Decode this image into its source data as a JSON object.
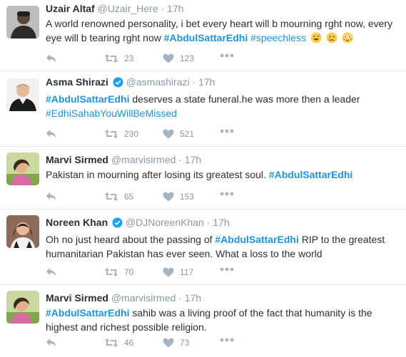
{
  "tweets": [
    {
      "name": "Uzair Altaf",
      "handle": "@Uzair_Here",
      "dot": "·",
      "time": "17h",
      "verified": false,
      "text_plain": "A world renowned personality, i bet every heart will b mourning rght now, every eye will b tearing rght now ",
      "hashtag1": "#AbdulSattarEdhi",
      "hashtag2": "#speechless",
      "emojis": [
        "grin-sweat-icon",
        "crying-face-icon",
        "flushed-face-icon"
      ],
      "retweets": "23",
      "likes": "123"
    },
    {
      "name": "Asma Shirazi",
      "handle": "@asmashirazi",
      "dot": "·",
      "time": "17h",
      "verified": true,
      "hashtag1": "#AbdulSattarEdhi",
      "text_plain": " deserves a state funeral.he was more then a leader",
      "hashtag2": "#EdhiSahabYouWillBeMissed",
      "retweets": "230",
      "likes": "521"
    },
    {
      "name": "Marvi Sirmed",
      "handle": "@marvisirmed",
      "dot": "·",
      "time": "17h",
      "verified": false,
      "text_plain": "Pakistan in mourning after losing its greatest soul. ",
      "hashtag1": "#AbdulSattarEdhi",
      "retweets": "65",
      "likes": "153"
    },
    {
      "name": "Noreen Khan",
      "handle": "@DJNoreenKhan",
      "dot": "·",
      "time": "17h",
      "verified": true,
      "text_plain": "Oh no just heard about the passing of ",
      "hashtag1": "#AbdulSattarEdhi",
      "text_plain2": " RIP to the greatest humanitarian Pakistan has ever seen. What a loss to the world",
      "retweets": "70",
      "likes": "117"
    },
    {
      "name": "Marvi Sirmed",
      "handle": "@marvisirmed",
      "dot": "·",
      "time": "17h",
      "verified": false,
      "hashtag1": "#AbdulSattarEdhi",
      "text_plain": " sahib was a living proof of the fact that humanity is the highest and richest possible religion.",
      "retweets": "46",
      "likes": "73"
    }
  ],
  "colors": {
    "hashtag": "#1b95e0",
    "muted": "#8899a6",
    "text": "#292f33",
    "verified": "#1da1f2",
    "divider": "#e1e8ed"
  }
}
